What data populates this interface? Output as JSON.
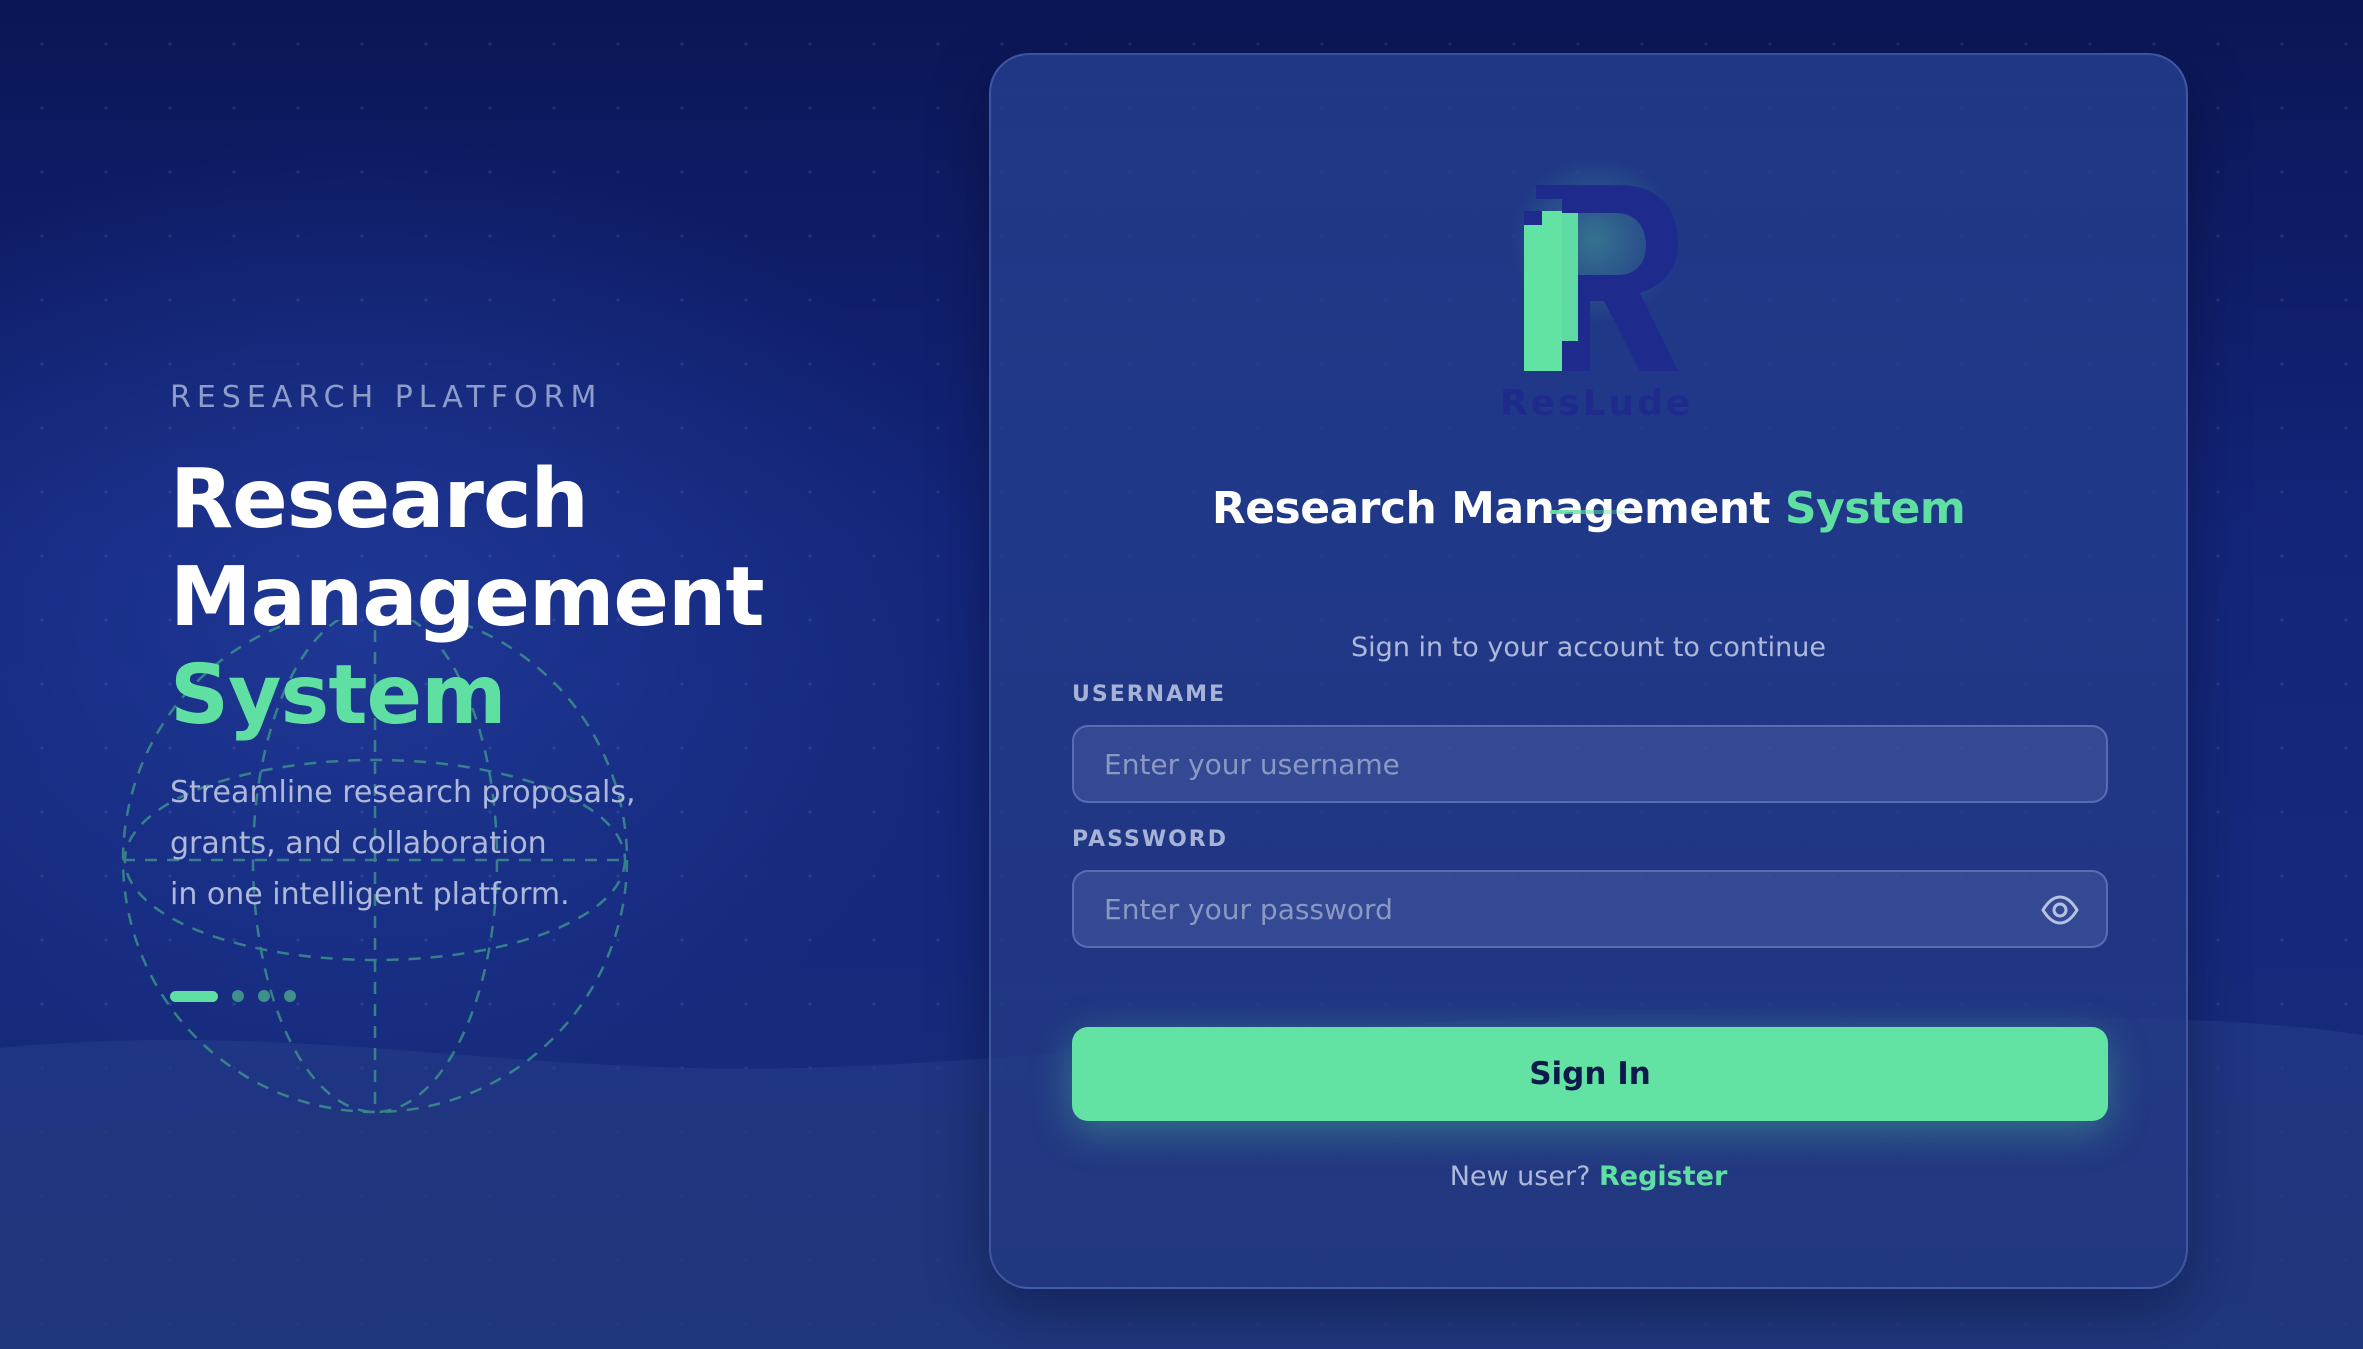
{
  "hero": {
    "eyebrow": "RESEARCH PLATFORM",
    "title_line1": "Research",
    "title_line2": "Management",
    "title_accent": "System",
    "desc_line1": "Streamline research proposals,",
    "desc_line2": "grants, and collaboration",
    "desc_line3": "in one intelligent platform.",
    "carousel": {
      "active_index": 0,
      "count": 4
    }
  },
  "card": {
    "brand": "ResLude",
    "title_main": "Research Management",
    "title_accent": "System",
    "subtitle": "Sign in to your account to continue",
    "username": {
      "label": "USERNAME",
      "placeholder": "Enter your username",
      "value": ""
    },
    "password": {
      "label": "PASSWORD",
      "placeholder": "Enter your password",
      "value": "",
      "toggle_icon": "eye-icon"
    },
    "signin_label": "Sign In",
    "register_prompt": "New user?",
    "register_link": "Register"
  },
  "colors": {
    "accent": "#5fe0a2",
    "background": "#13257a",
    "card": "#233f8f",
    "brand_dark": "#1f2b8c"
  }
}
